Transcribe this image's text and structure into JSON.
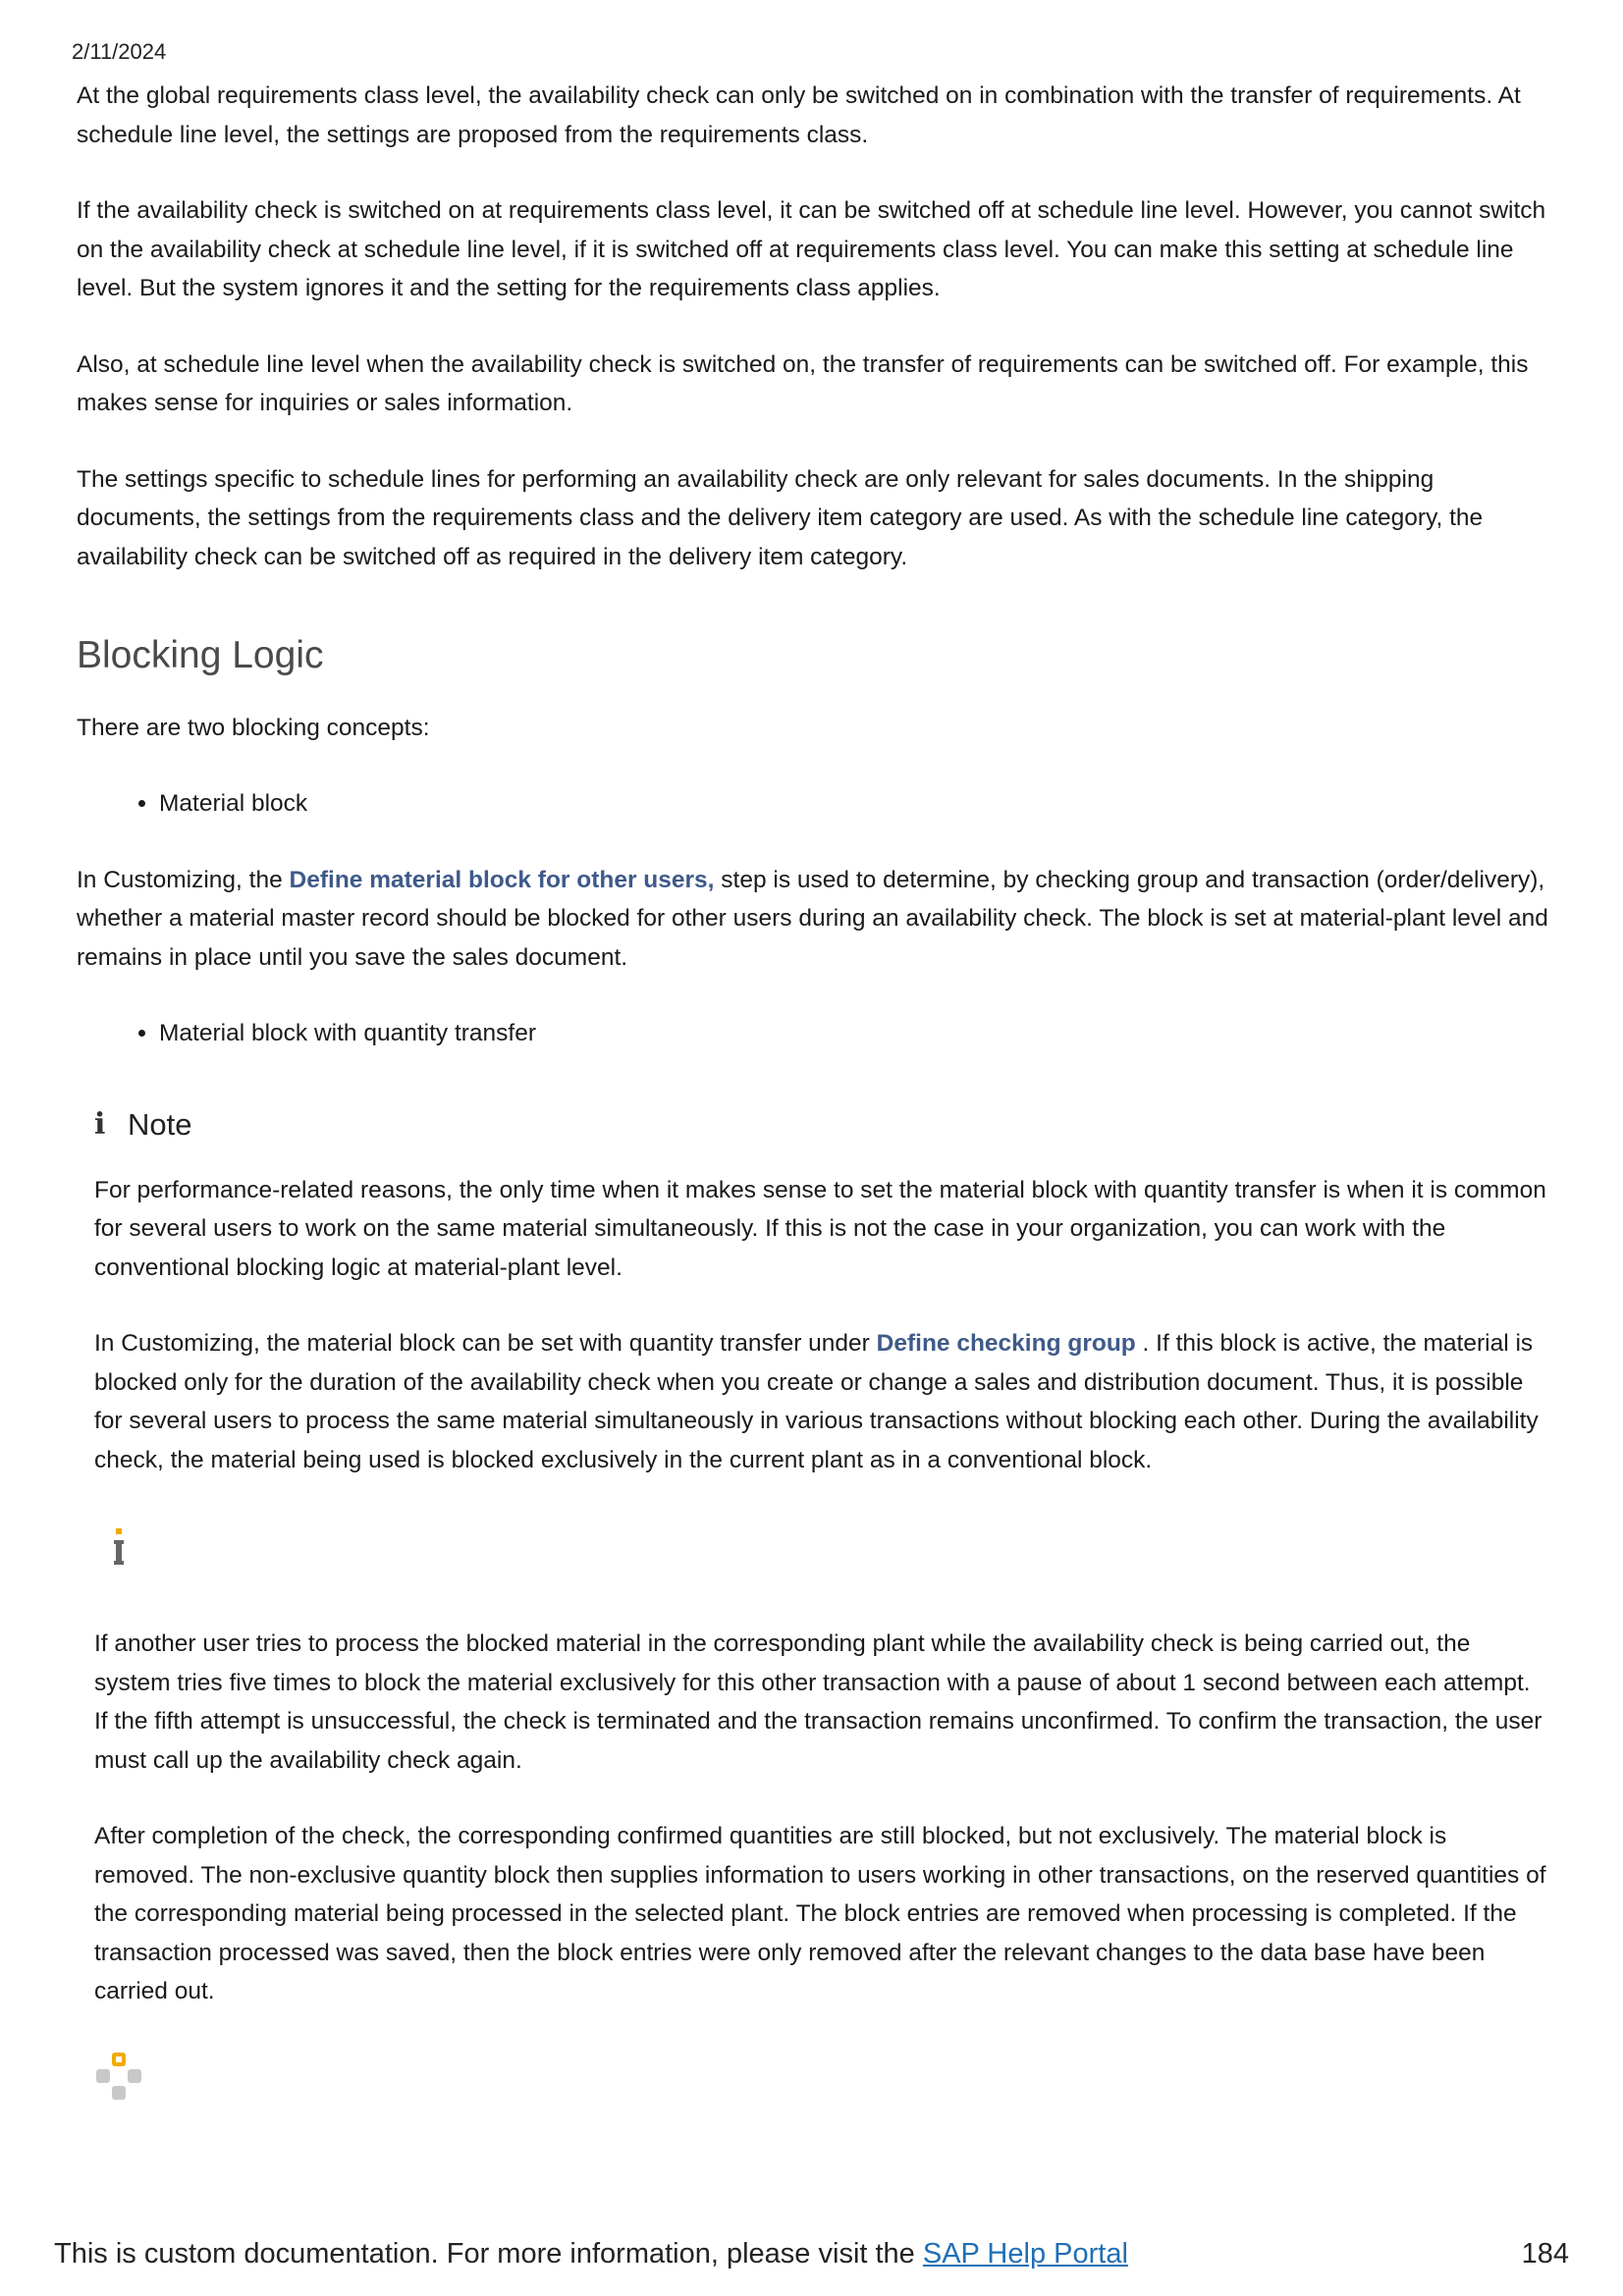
{
  "header": {
    "date": "2/11/2024"
  },
  "paragraphs_top": [
    "At the global requirements class level, the availability check can only be switched on in combination with the transfer of requirements. At schedule line level, the settings are proposed from the requirements class.",
    "If the availability check is switched on at requirements class level, it can be switched off at schedule line level. However, you cannot switch on the availability check at schedule line level, if it is switched off at requirements class level. You can make this setting at schedule line level. But the system ignores it and the setting for the requirements class applies.",
    "Also, at schedule line level when the availability check is switched on, the transfer of requirements can be switched off. For example, this makes sense for inquiries or sales information.",
    "The settings specific to schedule lines for performing an availability check are only relevant for sales documents. In the shipping documents, the settings from the requirements class and the delivery item category are used. As with the schedule line category, the availability check can be switched off as required in the delivery item category."
  ],
  "section": {
    "heading": "Blocking Logic",
    "intro": "There are two blocking concepts:",
    "bullet1": "Material block",
    "customizing1": {
      "before": "In Customizing, the ",
      "link": "Define material block for other users,",
      "after": " step is used to determine, by checking group and transaction (order/delivery), whether a material master record should be blocked for other users during an availability check. The block is set at material-plant level and remains in place until you save the sales document."
    },
    "bullet2": "Material block with quantity transfer"
  },
  "note": {
    "title": "Note",
    "para1": "For performance-related reasons, the only time when it makes sense to set the material block with quantity transfer is when it is common for several users to work on the same material simultaneously. If this is not the case in your organization, you can work with the conventional blocking logic at material-plant level.",
    "para2": {
      "before": "In Customizing, the material block can be set with quantity transfer under ",
      "link": "Define checking group",
      "after": " . If this block is active, the material is blocked only for the duration of the availability check when you create or change a sales and distribution document. Thus, it is possible for several users to process the same material simultaneously in various transactions without blocking each other. During the availability check, the material being used is blocked exclusively in the current plant as in a conventional block."
    },
    "para3": "If another user tries to process the blocked material in the corresponding plant while the availability check is being carried out, the system tries five times to block the material exclusively for this other transaction with a pause of about 1 second between each attempt. If the fifth attempt is unsuccessful, the check is terminated and the transaction remains unconfirmed. To confirm the transaction, the user must call up the availability check again.",
    "para4": "After completion of the check, the corresponding confirmed quantities are still blocked, but not exclusively. The material block is removed. The non-exclusive quantity block then supplies information to users working in other transactions, on the reserved quantities of the corresponding material being processed in the selected plant. The block entries are removed when processing is completed. If the transaction processed was saved, then the block entries were only removed after the relevant changes to the data base have been carried out."
  },
  "footer": {
    "text": "This is custom documentation. For more information, please visit the ",
    "link": "SAP Help Portal",
    "page_number": "184"
  },
  "colors": {
    "link": "#3f5a8a",
    "footer_link": "#1f6fb5",
    "accent_yellow": "#f0ab00",
    "icon_gray": "#c8c8c8"
  }
}
